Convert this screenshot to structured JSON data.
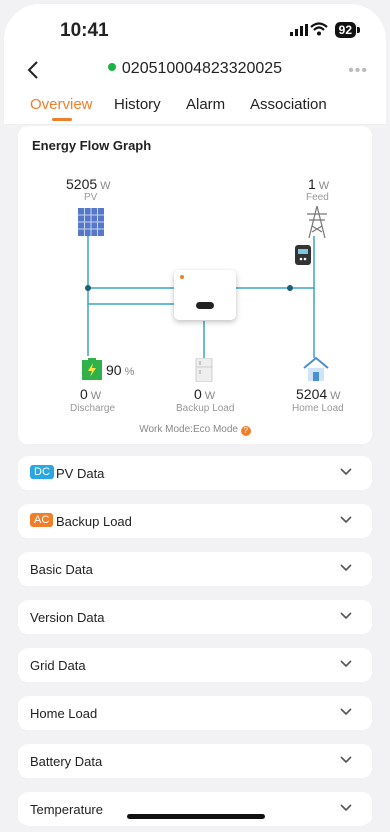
{
  "status": {
    "time": "10:41",
    "battery": "92"
  },
  "nav": {
    "device_id": "020510004823320025",
    "online_color": "#19b34a"
  },
  "tabs": [
    {
      "label": "Overview",
      "active": true
    },
    {
      "label": "History",
      "active": false
    },
    {
      "label": "Alarm",
      "active": false
    },
    {
      "label": "Association",
      "active": false
    }
  ],
  "energy": {
    "title": "Energy Flow Graph",
    "pv": {
      "value": "5205",
      "unit": "W",
      "label": "PV"
    },
    "feed": {
      "value": "1",
      "unit": "W",
      "label": "Feed"
    },
    "battery": {
      "soc": "90",
      "soc_unit": "%",
      "value": "0",
      "unit": "W",
      "label": "Discharge"
    },
    "backup": {
      "value": "0",
      "unit": "W",
      "label": "Backup Load"
    },
    "home": {
      "value": "5204",
      "unit": "W",
      "label": "Home Load"
    },
    "work_mode": "Work Mode:Eco Mode",
    "colors": {
      "line": "#3aa3c9",
      "accent": "#f07f2a",
      "battery": "#2fb24a"
    }
  },
  "sections": [
    {
      "label": "PV Data",
      "badge": "DC",
      "badge_color": "#2aa6e0"
    },
    {
      "label": "Backup Load",
      "badge": "AC",
      "badge_color": "#f07f2a"
    },
    {
      "label": "Basic Data"
    },
    {
      "label": "Version Data"
    },
    {
      "label": "Grid Data"
    },
    {
      "label": "Home Load"
    },
    {
      "label": "Battery Data"
    },
    {
      "label": "Temperature"
    }
  ]
}
